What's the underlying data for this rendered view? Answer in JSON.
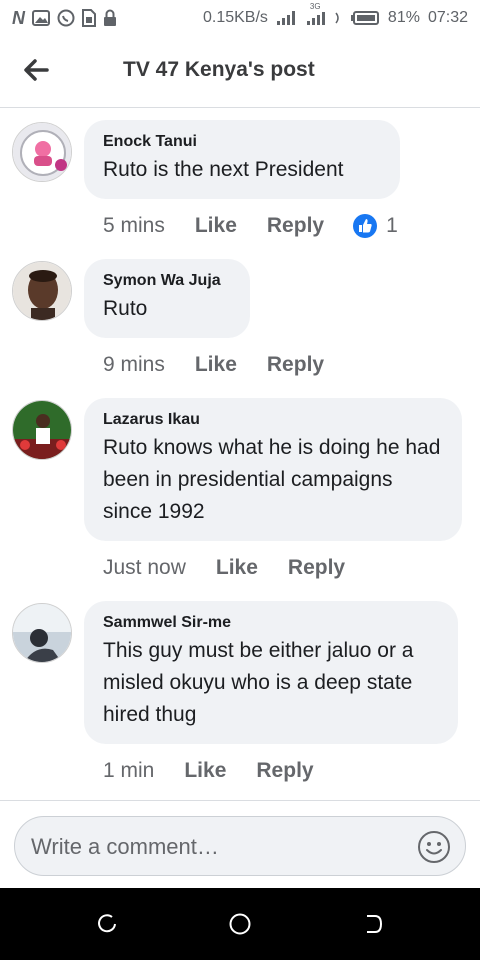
{
  "status_bar": {
    "speed": "0.15KB/s",
    "network_type": "3G",
    "battery": "81%",
    "time": "07:32",
    "icons": [
      "netflix-n-icon",
      "image-icon",
      "whatsapp-icon",
      "sim-icon",
      "lock-icon",
      "signal-icon",
      "signal-3g-icon",
      "vibrate-icon",
      "battery-icon"
    ]
  },
  "header": {
    "title": "TV 47 Kenya's post",
    "back_icon": "arrow-left-icon"
  },
  "comments": [
    {
      "author": "Enock Tanui",
      "text": "Ruto is the next President",
      "time": "5 mins",
      "like": "Like",
      "reply": "Reply",
      "reaction_count": "1"
    },
    {
      "author": "Symon Wa Juja",
      "text": "Ruto",
      "time": "9 mins",
      "like": "Like",
      "reply": "Reply"
    },
    {
      "author": "Lazarus Ikau",
      "text": "Ruto knows what he is doing he had been in presidential campaigns since 1992",
      "time": "Just now",
      "like": "Like",
      "reply": "Reply"
    },
    {
      "author": "Sammwel Sir-me",
      "text": "This guy must be either jaluo or a misled okuyu who is a deep state hired thug",
      "time": "1 min",
      "like": "Like",
      "reply": "Reply"
    }
  ],
  "comment_input": {
    "placeholder": "Write a comment…",
    "emoji_icon": "smiley-icon"
  },
  "colors": {
    "bubble": "#f0f2f5",
    "like_blue": "#1877f2",
    "meta_gray": "#65676b",
    "navbar": "#000000"
  }
}
